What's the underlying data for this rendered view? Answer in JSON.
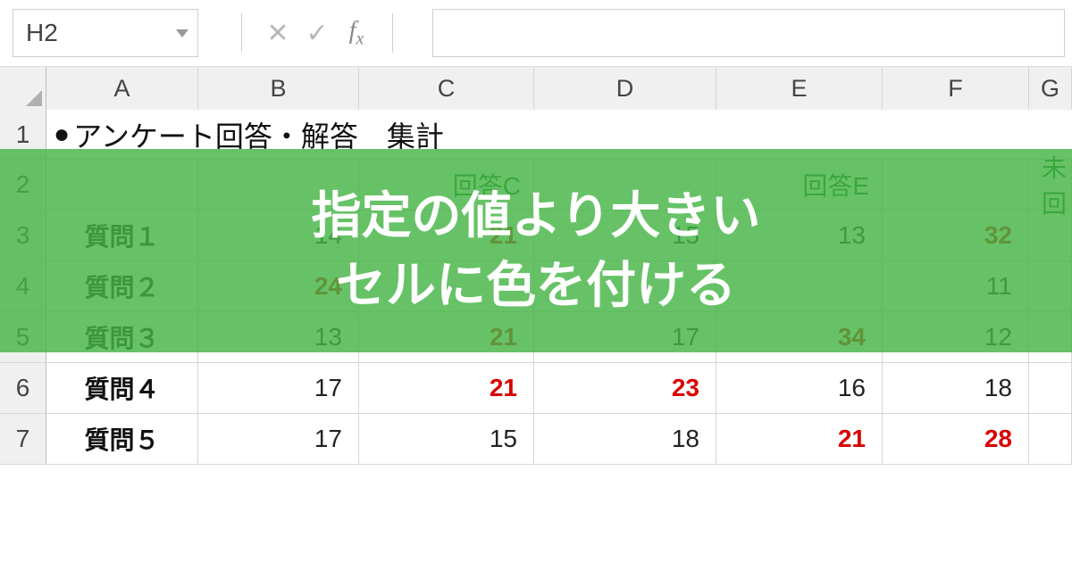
{
  "name_box": "H2",
  "formula_value": "",
  "columns": [
    "A",
    "B",
    "C",
    "D",
    "E",
    "F",
    "G"
  ],
  "title": "アンケート回答・解答　集計",
  "header_row": {
    "C": "回答C",
    "E": "回答E",
    "G": "未回"
  },
  "rows": [
    {
      "n": 3,
      "label": "質問１",
      "B": {
        "v": "14",
        "r": false
      },
      "C": {
        "v": "21",
        "r": true
      },
      "D": {
        "v": "15",
        "r": false
      },
      "E": {
        "v": "13",
        "r": false
      },
      "F": {
        "v": "32",
        "r": true
      }
    },
    {
      "n": 4,
      "label": "質問２",
      "B": {
        "v": "24",
        "r": true
      },
      "C": {
        "v": "",
        "r": false
      },
      "D": {
        "v": "",
        "r": false
      },
      "E": {
        "v": "",
        "r": false
      },
      "F": {
        "v": "11",
        "r": false
      }
    },
    {
      "n": 5,
      "label": "質問３",
      "B": {
        "v": "13",
        "r": false
      },
      "C": {
        "v": "21",
        "r": true
      },
      "D": {
        "v": "17",
        "r": false
      },
      "E": {
        "v": "34",
        "r": true
      },
      "F": {
        "v": "12",
        "r": false
      }
    },
    {
      "n": 6,
      "label": "質問４",
      "B": {
        "v": "17",
        "r": false
      },
      "C": {
        "v": "21",
        "r": true
      },
      "D": {
        "v": "23",
        "r": true
      },
      "E": {
        "v": "16",
        "r": false
      },
      "F": {
        "v": "18",
        "r": false
      }
    },
    {
      "n": 7,
      "label": "質問５",
      "B": {
        "v": "17",
        "r": false
      },
      "C": {
        "v": "15",
        "r": false
      },
      "D": {
        "v": "18",
        "r": false
      },
      "E": {
        "v": "21",
        "r": true
      },
      "F": {
        "v": "28",
        "r": true
      }
    }
  ],
  "overlay": {
    "line1": "指定の値より大きい",
    "line2": "セルに色を付ける"
  }
}
